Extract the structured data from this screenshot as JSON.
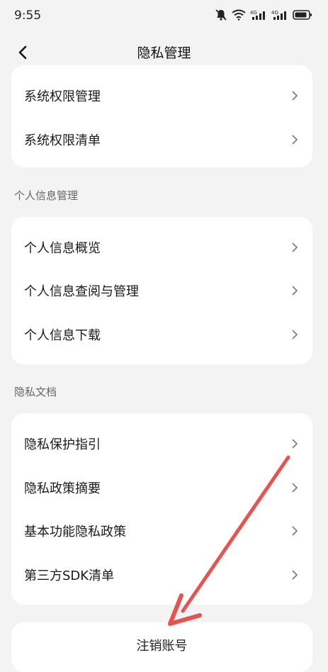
{
  "status_bar": {
    "time": "9:55",
    "signal_1": "4G",
    "signal_2": "4G"
  },
  "header": {
    "title": "隐私管理"
  },
  "system_permissions": {
    "items": [
      {
        "label": "系统权限管理"
      },
      {
        "label": "系统权限清单"
      }
    ]
  },
  "personal_info": {
    "section_title": "个人信息管理",
    "items": [
      {
        "label": "个人信息概览"
      },
      {
        "label": "个人信息查阅与管理"
      },
      {
        "label": "个人信息下载"
      }
    ]
  },
  "privacy_docs": {
    "section_title": "隐私文档",
    "items": [
      {
        "label": "隐私保护指引"
      },
      {
        "label": "隐私政策摘要"
      },
      {
        "label": "基本功能隐私政策"
      },
      {
        "label": "第三方SDK清单"
      }
    ]
  },
  "account": {
    "cancel_label": "注销账号"
  },
  "annotation": {
    "arrow_color": "#e8524f"
  },
  "theme": {
    "card_bg": "#ffffff",
    "page_bg": "#f3f3f3",
    "section_text": "#666666"
  }
}
